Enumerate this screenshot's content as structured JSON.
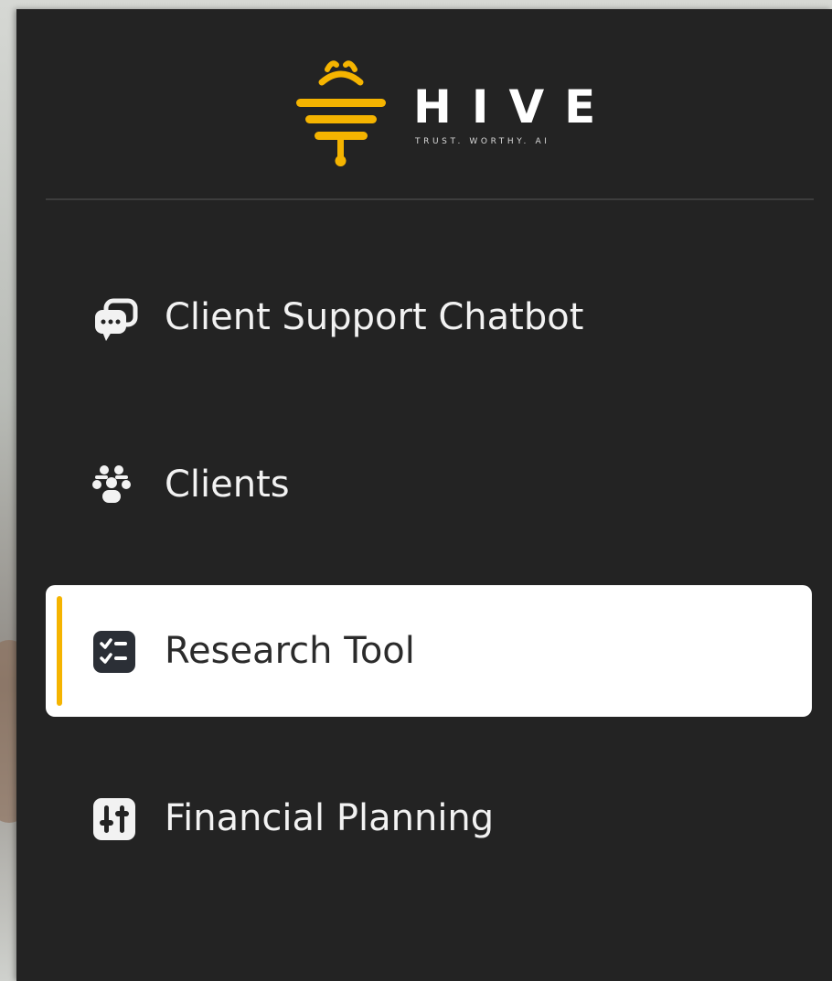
{
  "brand": {
    "name": "HIVE",
    "tagline": "TRUST. WORTHY. AI",
    "accent_color": "#f5b400",
    "logo_icon": "bee-hive-icon"
  },
  "sidebar": {
    "background": "#232323",
    "items": [
      {
        "label": "Client Support Chatbot",
        "icon": "chat-bubbles-icon",
        "active": false
      },
      {
        "label": "Clients",
        "icon": "users-group-icon",
        "active": false
      },
      {
        "label": "Research Tool",
        "icon": "checklist-icon",
        "active": true
      },
      {
        "label": "Financial Planning",
        "icon": "sliders-icon",
        "active": false
      }
    ]
  }
}
